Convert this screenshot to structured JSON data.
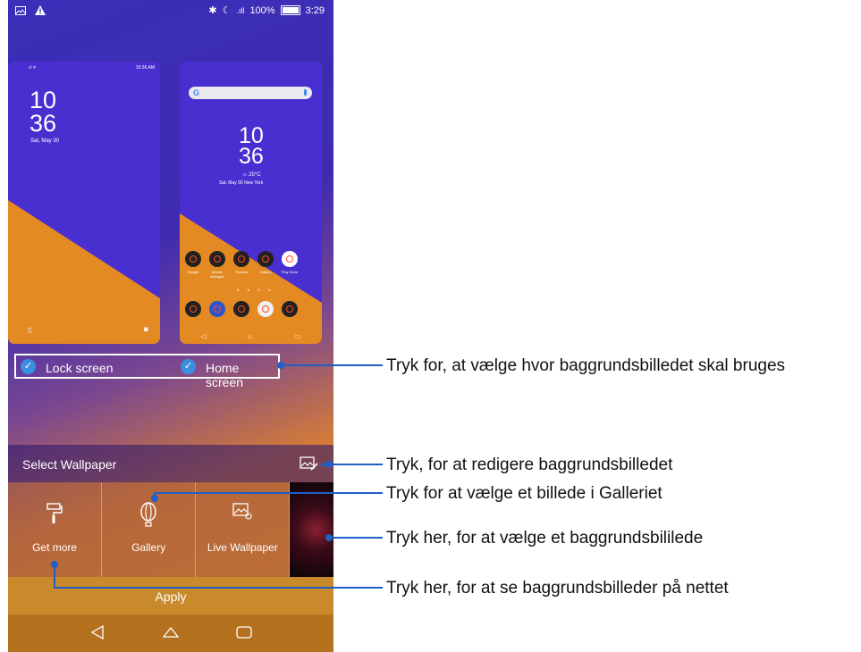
{
  "status_bar": {
    "battery": "100%",
    "time": "3:29"
  },
  "lock_preview": {
    "status_time": "10:36 AM",
    "time_h": "10",
    "time_m": "36",
    "date": "Sat, May 30"
  },
  "home_preview": {
    "search_g": "G",
    "time_h": "10",
    "time_m": "36",
    "weather": "25°C",
    "date": "Sat, May 30  New York",
    "apps": [
      "Google",
      "Mobile Manager",
      "Themes",
      "Gallery",
      "Play Store"
    ]
  },
  "selection": {
    "lock_label": "Lock screen",
    "home_label": "Home screen"
  },
  "panel": {
    "title": "Select Wallpaper",
    "options": [
      "Get more",
      "Gallery",
      "Live Wallpaper"
    ],
    "apply": "Apply"
  },
  "callouts": {
    "select_target": "Tryk for, at vælge hvor baggrundsbilledet skal bruges",
    "edit": "Tryk, for at redigere baggrundsbilledet",
    "gallery": "Tryk for at vælge et billede i Galleriet",
    "wallpaper": "Tryk her, for at vælge et baggrundsbililede",
    "online": "Tryk her, for at se baggrundsbilleder på nettet"
  },
  "colors": {
    "accent": "#3a8fe0",
    "callout_line": "#1f5fc8"
  }
}
